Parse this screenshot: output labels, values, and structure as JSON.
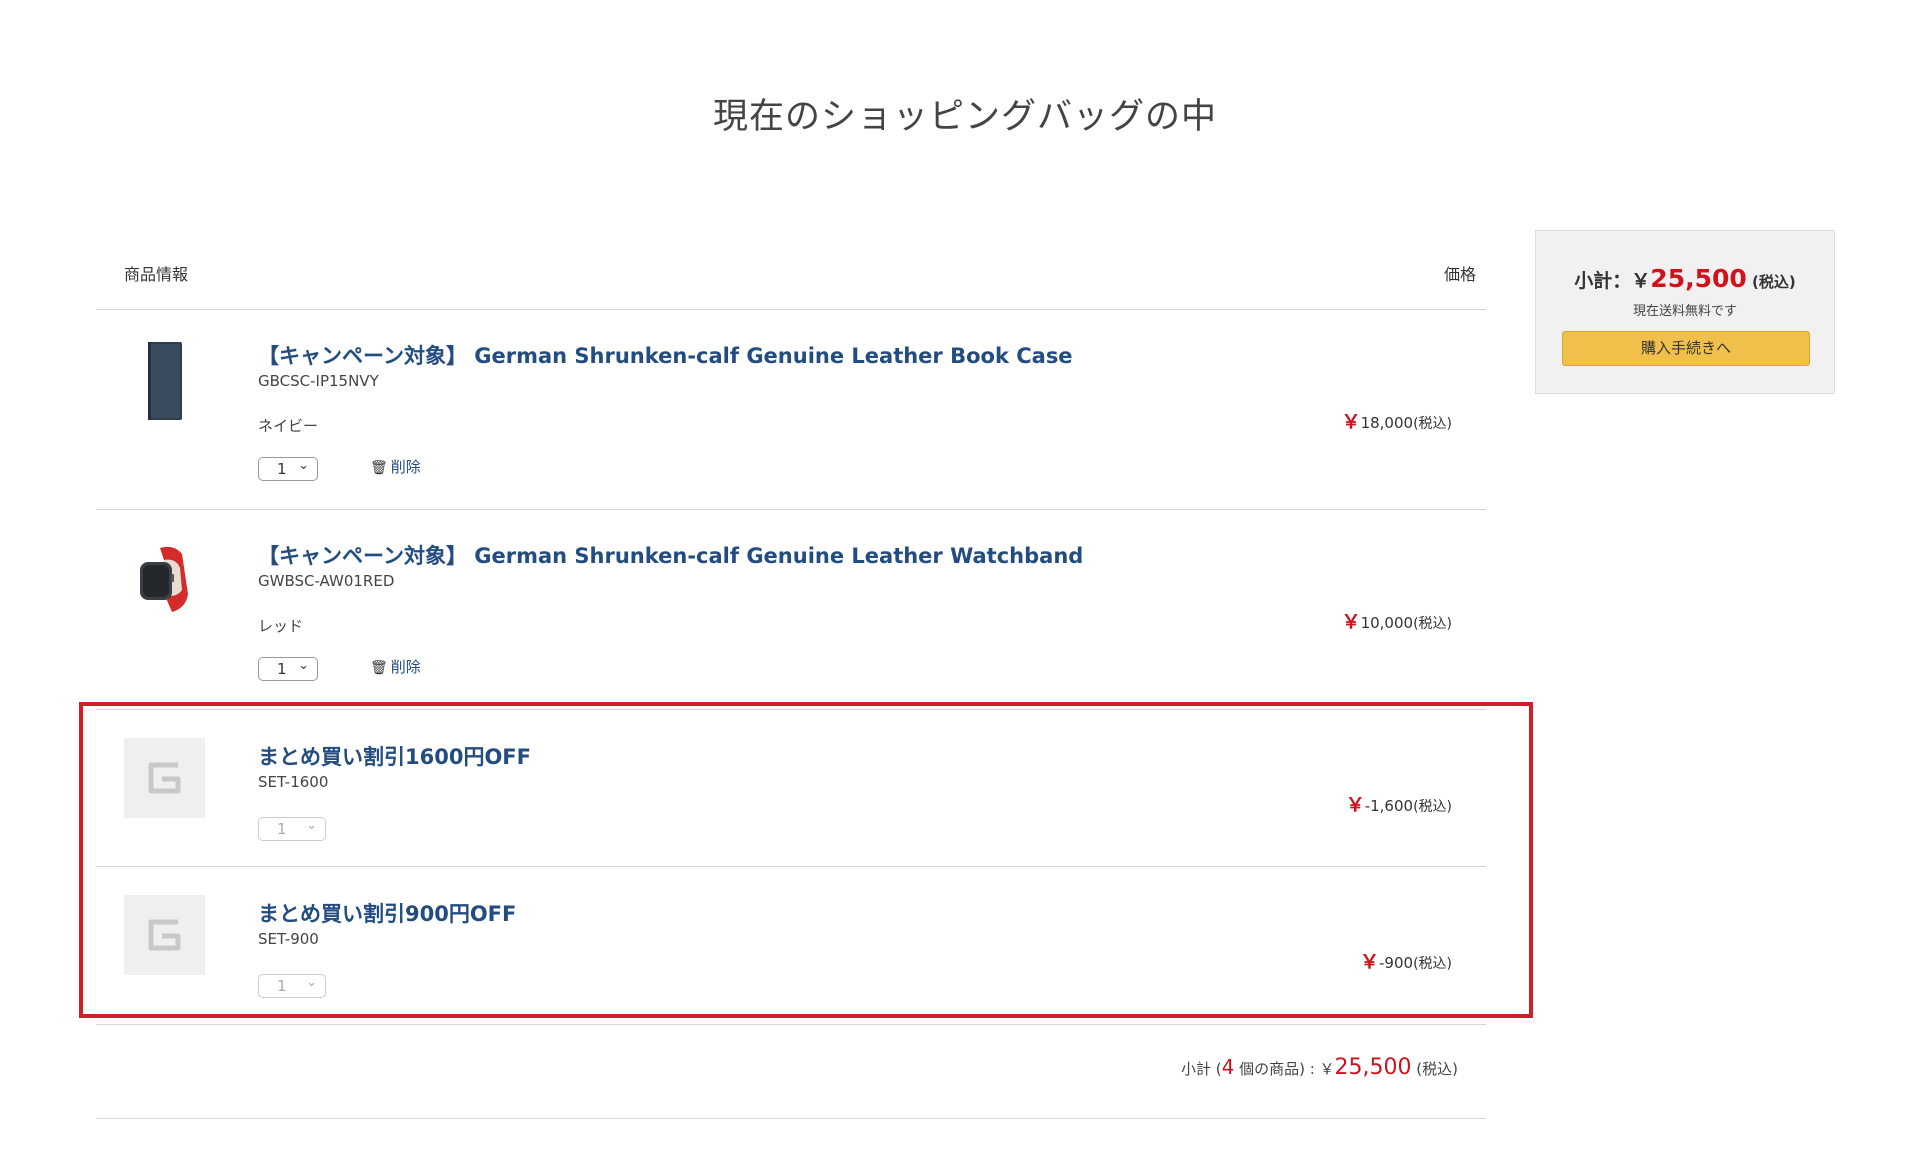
{
  "page": {
    "title": "現在のショッピングバッグの中"
  },
  "cart": {
    "header": {
      "info": "商品情報",
      "price": "価格"
    },
    "products": [
      {
        "name": "【キャンペーン対象】 German Shrunken-calf Genuine Leather Book Case",
        "sku": "GBCSC-IP15NVY",
        "variant": "ネイビー",
        "qty": "1",
        "delete_label": "削除",
        "price_value": "18,000",
        "image": "navy-book-case-thumbnail"
      },
      {
        "name": "【キャンペーン対象】 German Shrunken-calf Genuine Leather Watchband",
        "sku": "GWBSC-AW01RED",
        "variant": "レッド",
        "qty": "1",
        "delete_label": "削除",
        "price_value": "10,000",
        "image": "red-watchband-thumbnail"
      }
    ],
    "discounts": [
      {
        "name": "まとめ買い割引1600円OFF",
        "sku": "SET-1600",
        "qty": "1",
        "price_value": "-1,600",
        "image": "brand-logo-placeholder"
      },
      {
        "name": "まとめ買い割引900円OFF",
        "sku": "SET-900",
        "qty": "1",
        "price_value": "-900",
        "image": "brand-logo-placeholder"
      }
    ],
    "currency": "￥",
    "tax_label": "(税込)",
    "totals": {
      "prefix": "小計 (",
      "count": "4",
      "count_suffix": " 個の商品) : ￥",
      "amount": "25,500",
      "tax": " (税込)"
    }
  },
  "summary": {
    "label": "小計：￥",
    "amount": "25,500",
    "tax": " (税込)",
    "shipping_note": "現在送料無料です",
    "checkout_label": "購入手続きへ"
  },
  "colors": {
    "price_red": "#d0121b",
    "link_blue": "#234d80",
    "checkout_yellow": "#f1c04b",
    "highlight_red": "#cf1f27"
  }
}
